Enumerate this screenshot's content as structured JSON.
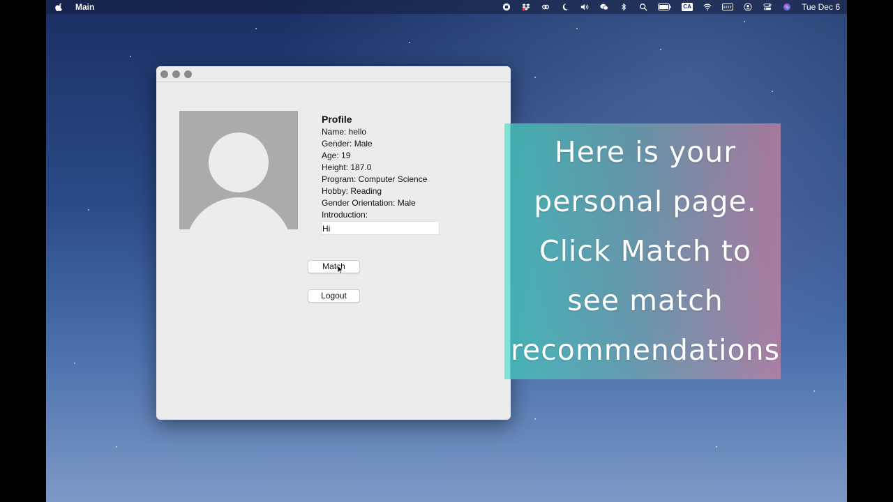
{
  "menubar": {
    "app_name": "Main",
    "date": "Tue Dec 6",
    "keyboard_layout": "CA",
    "icons": [
      "apple-icon",
      "stop-recording-icon",
      "dropbox-icon",
      "creative-cloud-icon",
      "moon-icon",
      "volume-icon",
      "wechat-icon",
      "bluetooth-icon",
      "search-icon",
      "battery-icon",
      "keyboard-layout-icon",
      "wifi-icon",
      "keyboard-icon",
      "user-icon",
      "control-center-icon",
      "siri-icon"
    ]
  },
  "window": {
    "profile": {
      "title": "Profile",
      "name": "Name: hello",
      "gender": "Gender: Male",
      "age": "Age: 19",
      "height": "Height: 187.0",
      "program": "Program: Computer Science",
      "hobby": "Hobby: Reading",
      "orientation": "Gender Orientation: Male",
      "introduction_label": "Introduction:",
      "introduction_value": "Hi"
    },
    "buttons": {
      "match": "Match",
      "logout": "Logout"
    }
  },
  "overlay": {
    "lines": [
      "Here is your",
      "personal page.",
      "Click Match to",
      "see match",
      "recommendations"
    ]
  }
}
